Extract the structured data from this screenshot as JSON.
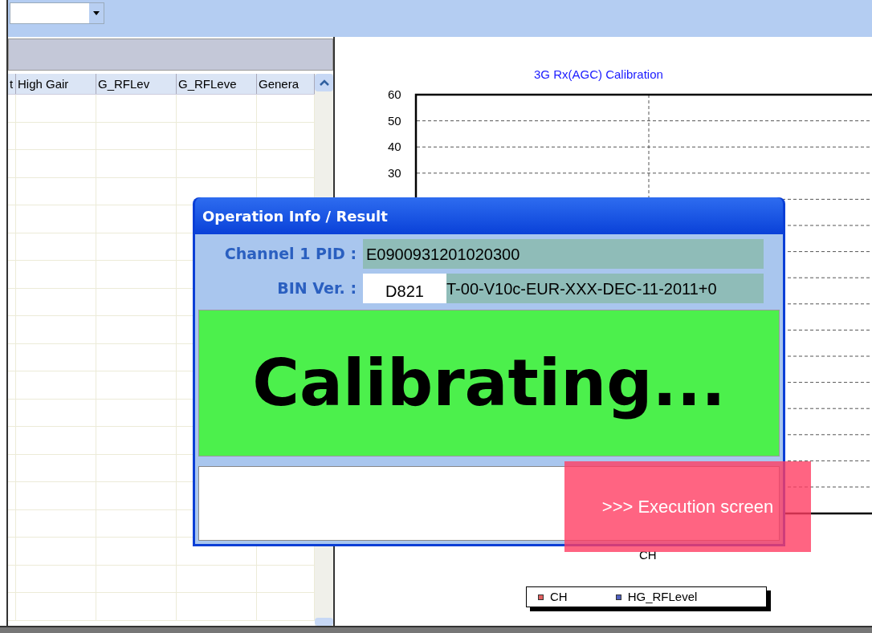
{
  "table": {
    "columns": [
      "t",
      "High Gair",
      "G_RFLev",
      "G_RFLeve",
      "Genera"
    ]
  },
  "chart": {
    "title": "3G Rx(AGC) Calibration",
    "y_ticks": [
      "60",
      "50",
      "40",
      "30"
    ],
    "xlabel": "CH",
    "legend": [
      {
        "label": "CH",
        "color": "#e06060"
      },
      {
        "label": "HG_RFLevel",
        "color": "#5060c0"
      }
    ]
  },
  "dialog": {
    "title": "Operation Info / Result",
    "fields": [
      {
        "label": "Channel 1 PID :",
        "value": "E0900931201020300"
      },
      {
        "label": "BIN Ver. :",
        "redaction": "D821",
        "value": "T-00-V10c-EUR-XXX-DEC-11-2011+0"
      }
    ],
    "status": "Calibrating..."
  },
  "annotation": ">>> Execution screen"
}
